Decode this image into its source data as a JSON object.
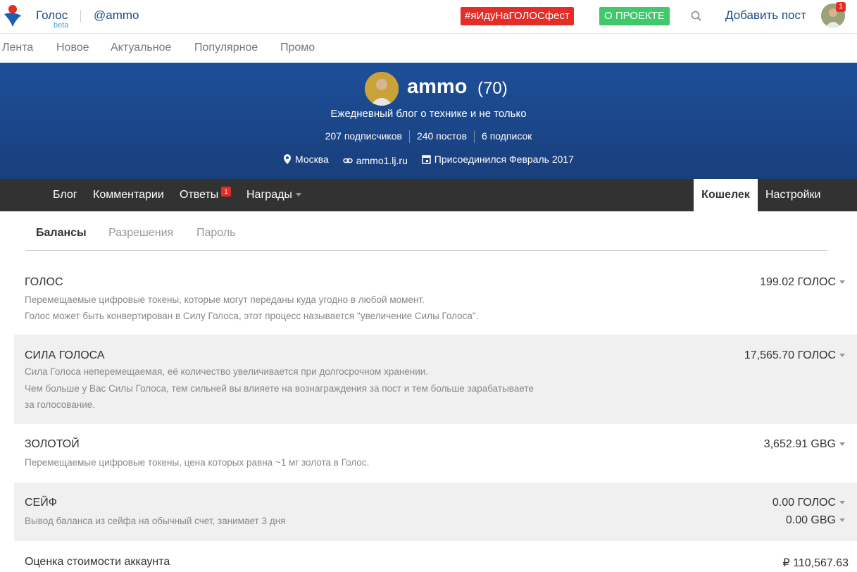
{
  "header": {
    "brand": "Голос",
    "beta": "beta",
    "handle": "@ammo",
    "tag_button": "#яИдуНаГОЛОСфест",
    "about_button": "О ПРОЕКТЕ",
    "add_post": "Добавить пост",
    "notifications": "1",
    "colors": {
      "tag": "#e52d27",
      "about": "#3ec96b",
      "link": "#1a4a8a"
    }
  },
  "main_nav": {
    "items": [
      {
        "label": "Лента"
      },
      {
        "label": "Новое"
      },
      {
        "label": "Актуальное"
      },
      {
        "label": "Популярное"
      },
      {
        "label": "Промо"
      }
    ]
  },
  "profile": {
    "name": "ammo",
    "reputation": "(70)",
    "description": "Ежедневный блог о технике и не только",
    "stats": {
      "followers": "207 подписчиков",
      "posts": "240 постов",
      "following": "6 подписок"
    },
    "location": "Москва",
    "website": "ammo1.lj.ru",
    "joined": "Присоединился Февраль 2017",
    "icons": {
      "location": "location-pin-icon",
      "link": "link-icon",
      "calendar": "calendar-icon"
    }
  },
  "profile_nav": {
    "blog": "Блог",
    "comments": "Комментарии",
    "replies": "Ответы",
    "replies_badge": "1",
    "rewards": "Награды",
    "wallet": "Кошелек",
    "settings": "Настройки"
  },
  "wallet_tabs": {
    "balances": "Балансы",
    "permissions": "Разрешения",
    "password": "Пароль"
  },
  "balances": {
    "golos": {
      "title": "ГОЛОС",
      "desc1": "Перемещаемые цифровые токены, которые могут переданы куда угодно в любой момент.",
      "desc2": "Голос может быть конвертирован в Силу Голоса, этот процесс называется \"увеличение Силы Голоса\".",
      "value": "199.02 ГОЛОС"
    },
    "power": {
      "title": "СИЛА ГОЛОСА",
      "desc1": "Сила Голоса неперемещаемая, её количество увеличивается при долгосрочном хранении.",
      "desc2": "Чем больше у Вас Силы Голоса, тем сильней вы влияете на вознаграждения за пост и тем больше зарабатываете",
      "desc3": "за голосование.",
      "value": "17,565.70 ГОЛОС"
    },
    "gold": {
      "title": "ЗОЛОТОЙ",
      "desc1": "Перемещаемые цифровые токены, цена которых равна ~1 мг золота в Голос.",
      "value": "3,652.91 GBG"
    },
    "safe": {
      "title": "СЕЙФ",
      "desc1": "Вывод баланса из сейфа на обычный счет, занимает 3 дня",
      "value1": "0.00 ГОЛОС",
      "value2": "0.00 GBG"
    },
    "estimate": {
      "title": "Оценка стоимости аккаунта",
      "value": "₽ 110,567.63"
    }
  }
}
